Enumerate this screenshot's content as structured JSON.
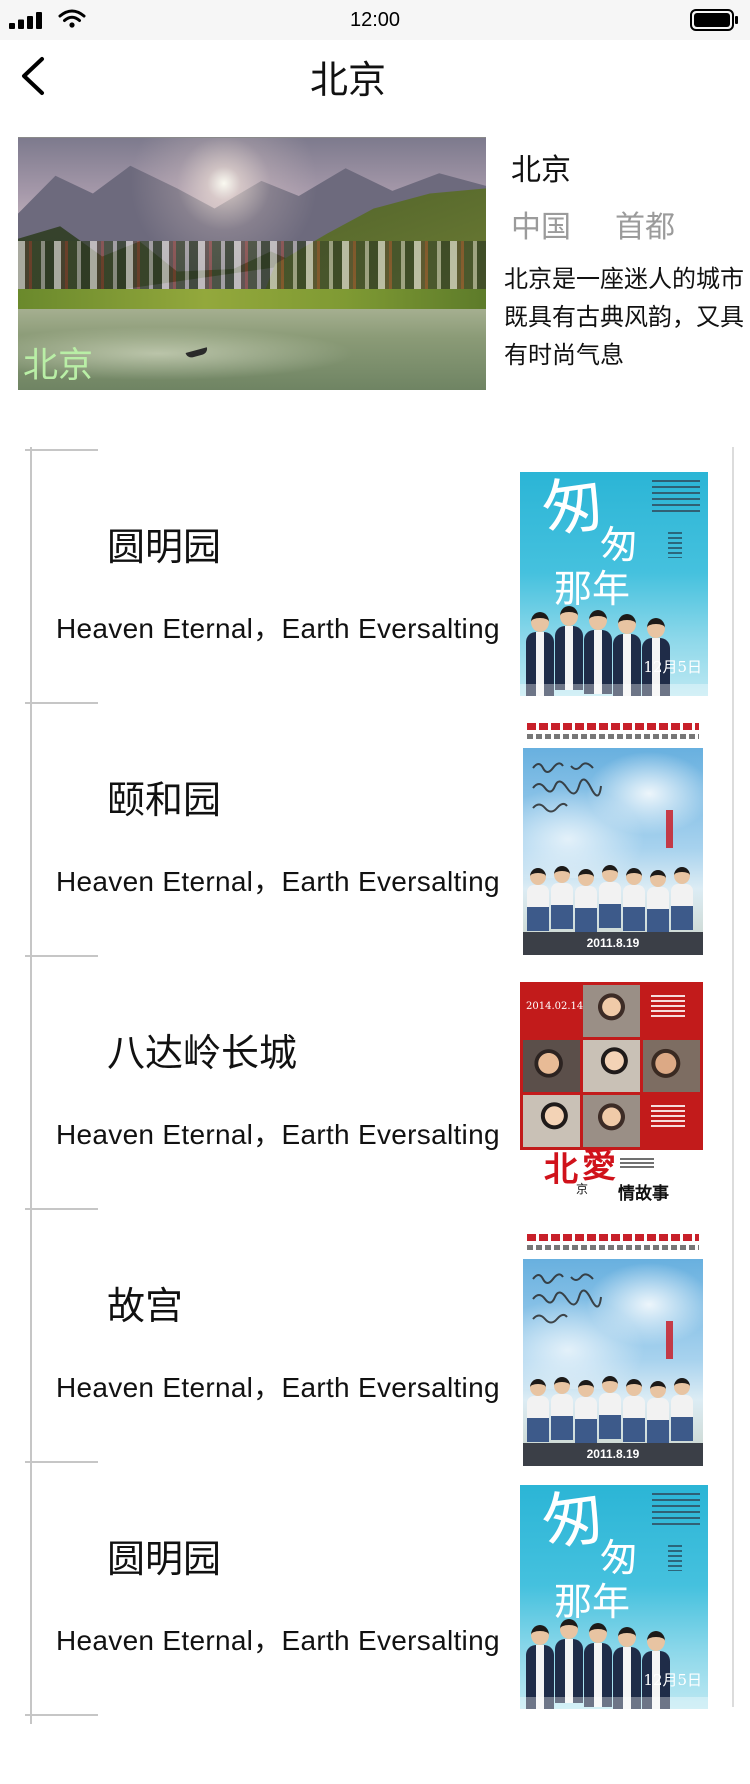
{
  "status_bar": {
    "time": "12:00",
    "icons": [
      "signal-icon",
      "wifi-icon",
      "battery-icon"
    ]
  },
  "nav": {
    "title": "北京",
    "back_icon": "chevron-left-icon"
  },
  "city": {
    "image_label": "北京",
    "name": "北京",
    "tags": [
      "中国",
      "首都"
    ],
    "description_lines": [
      "北京是一座迷人的城市",
      "既具有古典风韵，又具",
      "有时尚气息"
    ]
  },
  "attractions": [
    {
      "name": "圆明园",
      "description": "Heaven Eternal，Earth Eversalting",
      "poster_image": "poster-a-image"
    },
    {
      "name": "颐和园",
      "description": "Heaven Eternal，Earth Eversalting",
      "poster_image": "poster-b-image"
    },
    {
      "name": "八达岭长城",
      "description": "Heaven Eternal，Earth Eversalting",
      "poster_image": "poster-c-image"
    },
    {
      "name": "故宫",
      "description": "Heaven Eternal，Earth Eversalting",
      "poster_image": "poster-b-image"
    },
    {
      "name": "圆明园",
      "description": "Heaven Eternal，Earth Eversalting",
      "poster_image": "poster-a-image"
    }
  ],
  "posters": {
    "a": {
      "glyphs": [
        "匆",
        "匆",
        "那年"
      ],
      "date": "12月5日"
    },
    "b": {
      "date": "2011.8.19"
    },
    "c": {
      "date": "2014.02.14",
      "logo": [
        "北",
        "愛",
        "京",
        "情故事"
      ]
    }
  },
  "colors": {
    "image_label": "#b9efa6",
    "tag_text": "#9b9b9b",
    "timeline": "#c6c6c6",
    "status_bar_bg": "#f6f6f6"
  }
}
